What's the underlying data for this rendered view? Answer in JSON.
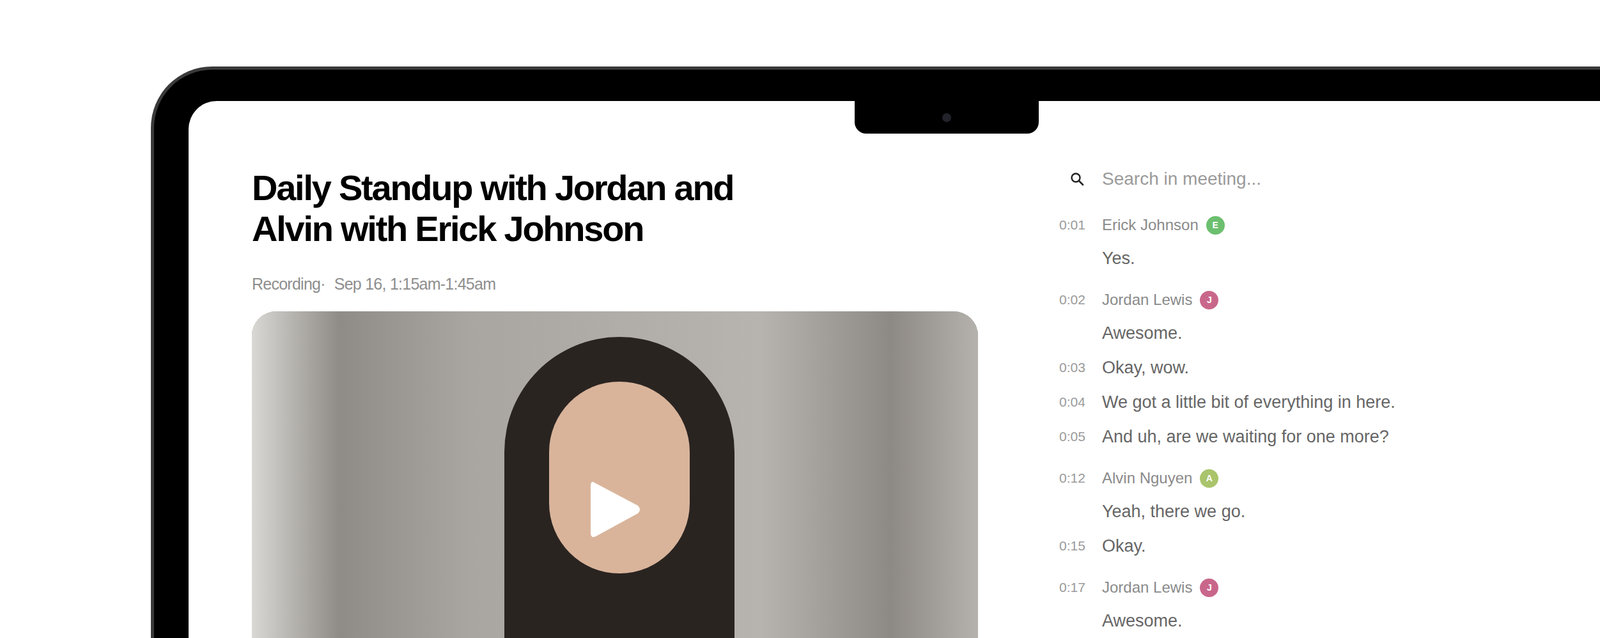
{
  "meeting": {
    "title": "Daily Standup with Jordan and Alvin with Erick Johnson",
    "recording_label": "Recording·",
    "time_range": "Sep 16, 1:15am-1:45am"
  },
  "search": {
    "placeholder": "Search in meeting..."
  },
  "transcript": [
    {
      "kind": "speaker",
      "time": "0:01",
      "speaker": "Erick Johnson",
      "initial": "E",
      "color": "#6cbf6f",
      "text": "Yes."
    },
    {
      "kind": "speaker",
      "time": "0:02",
      "speaker": "Jordan Lewis",
      "initial": "J",
      "color": "#c9678b",
      "text": "Awesome."
    },
    {
      "kind": "line",
      "time": "0:03",
      "text": "Okay, wow."
    },
    {
      "kind": "line",
      "time": "0:04",
      "text": "We got a little bit of everything in here."
    },
    {
      "kind": "line",
      "time": "0:05",
      "text": "And uh, are we waiting for one more?"
    },
    {
      "kind": "speaker",
      "time": "0:12",
      "speaker": "Alvin Nguyen",
      "initial": "A",
      "color": "#a9c46b",
      "text": "Yeah, there we go."
    },
    {
      "kind": "line",
      "time": "0:15",
      "text": "Okay."
    },
    {
      "kind": "speaker",
      "time": "0:17",
      "speaker": "Jordan Lewis",
      "initial": "J",
      "color": "#c9678b",
      "text": "Awesome."
    }
  ]
}
